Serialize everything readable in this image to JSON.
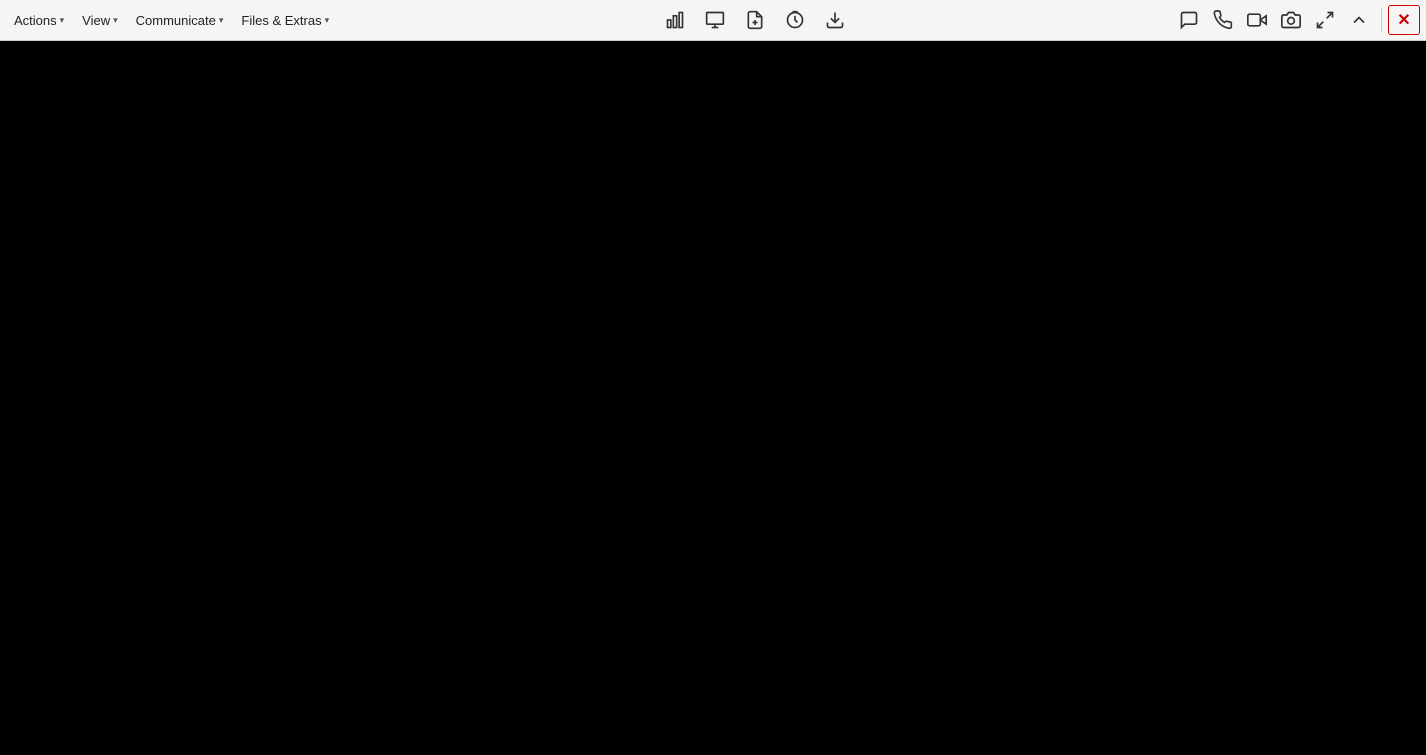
{
  "toolbar": {
    "menus": [
      {
        "id": "actions",
        "label": "Actions",
        "has_chevron": true
      },
      {
        "id": "view",
        "label": "View",
        "has_chevron": true
      },
      {
        "id": "communicate",
        "label": "Communicate",
        "has_chevron": true
      },
      {
        "id": "files-extras",
        "label": "Files & Extras",
        "has_chevron": true
      }
    ],
    "center_icons": [
      {
        "id": "stats",
        "title": "Stats"
      },
      {
        "id": "presentation",
        "title": "Presentation"
      },
      {
        "id": "share-file",
        "title": "Share File"
      },
      {
        "id": "timer",
        "title": "Timer"
      },
      {
        "id": "download",
        "title": "Download"
      }
    ],
    "right_icons": [
      {
        "id": "chat",
        "title": "Chat"
      },
      {
        "id": "phone",
        "title": "Phone"
      },
      {
        "id": "video",
        "title": "Video"
      },
      {
        "id": "camera",
        "title": "Camera"
      },
      {
        "id": "fullscreen",
        "title": "Fullscreen"
      },
      {
        "id": "arrow-up",
        "title": "Scroll Up"
      }
    ],
    "close_label": "✕"
  },
  "main": {
    "background": "#000000"
  }
}
